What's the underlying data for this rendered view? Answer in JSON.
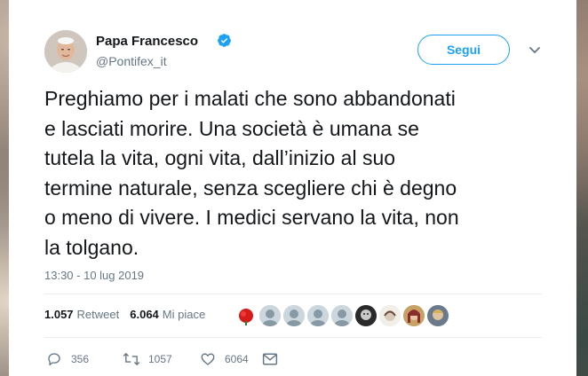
{
  "tweet": {
    "author_name": "Papa Francesco",
    "author_handle": "@Pontifex_it",
    "follow_label": "Segui",
    "text_lines": [
      "Preghiamo per i malati che sono abbandonati",
      "e lasciati morire. Una società è umana se",
      "tutela la vita, ogni vita, dall’inizio al suo",
      "termine naturale, senza scegliere chi è degno",
      "o meno di vivere. I medici servano la vita, non",
      "la tolgano."
    ],
    "timestamp": "13:30 - 10 lug 2019",
    "retweets_count": "1.057",
    "retweets_label": "Retweet",
    "likes_count": "6.064",
    "likes_label": "Mi piace",
    "actions": {
      "reply_count": "356",
      "retweet_count": "1057",
      "like_count": "6064"
    }
  },
  "colors": {
    "accent": "#1da1f2",
    "text": "#14171a",
    "muted": "#657786"
  },
  "icons": [
    "verified-badge-icon",
    "chevron-down-icon",
    "reply-icon",
    "retweet-icon",
    "like-icon",
    "direct-message-icon"
  ]
}
